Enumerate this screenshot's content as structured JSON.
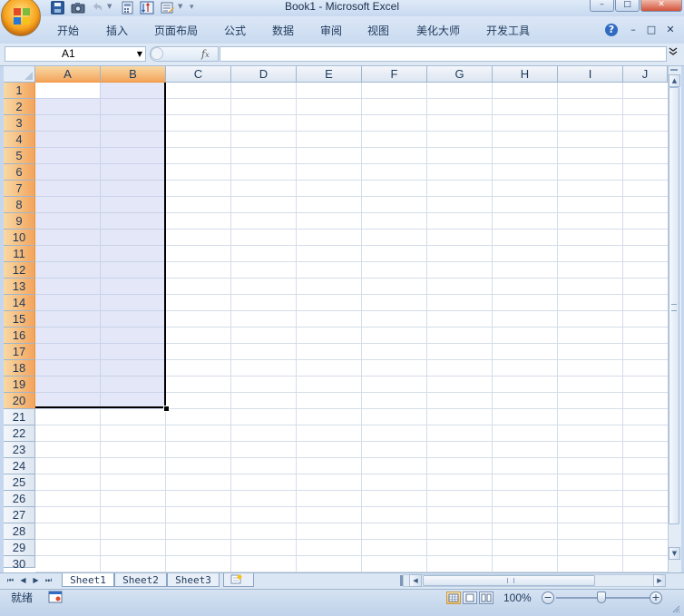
{
  "window": {
    "title": "Book1 - Microsoft Excel",
    "minimize": "–",
    "restore": "□",
    "close": "✕"
  },
  "ribbon": {
    "tabs": [
      "开始",
      "插入",
      "页面布局",
      "公式",
      "数据",
      "审阅",
      "视图",
      "美化大师",
      "开发工具"
    ],
    "help": "?",
    "minimize": "–",
    "restore": "□",
    "close": "✕"
  },
  "formula_bar": {
    "name_box": "A1",
    "fx": "fx",
    "formula": ""
  },
  "grid": {
    "columns": [
      "A",
      "B",
      "C",
      "D",
      "E",
      "F",
      "G",
      "H",
      "I",
      "J"
    ],
    "rows": [
      "1",
      "2",
      "3",
      "4",
      "5",
      "6",
      "7",
      "8",
      "9",
      "10",
      "11",
      "12",
      "13",
      "14",
      "15",
      "16",
      "17",
      "18",
      "19",
      "20",
      "21",
      "22",
      "23",
      "24",
      "25",
      "26",
      "27",
      "28",
      "29",
      "30"
    ],
    "selected_columns": [
      "A",
      "B"
    ],
    "selected_rows_from": 1,
    "selected_rows_to": 20,
    "active_cell": "A1",
    "selection_range": "A1:B20"
  },
  "sheets": {
    "tabs": [
      "Sheet1",
      "Sheet2",
      "Sheet3"
    ],
    "active": "Sheet1",
    "nav": [
      "⏮",
      "◀",
      "▶",
      "⏭"
    ]
  },
  "status": {
    "text": "就绪",
    "zoom": "100%",
    "zoom_out": "−",
    "zoom_in": "+"
  },
  "colors": {
    "selected_header": "#f3a45c",
    "selection_fill": "#e4e8f7",
    "chrome": "#c5d7ee"
  }
}
